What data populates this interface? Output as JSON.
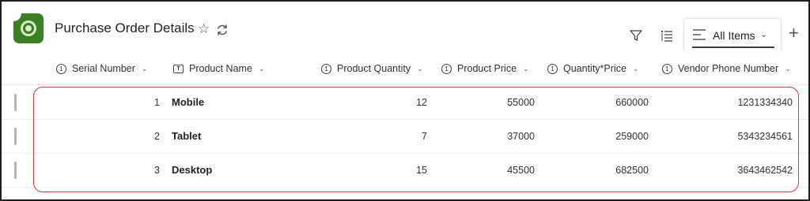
{
  "header": {
    "title": "Purchase Order Details",
    "favorite_icon": "star-icon",
    "sync_icon": "sync-icon",
    "filter_icon": "filter-icon",
    "edit_columns_icon": "list-icon",
    "view_tab_label": "All Items",
    "view_tab_icon": "lines-icon",
    "add_view_label": "+",
    "colors": {
      "logo": "#3a7f22",
      "highlight": "#d63c3c"
    }
  },
  "columns": [
    {
      "label": "Serial Number",
      "type": "number"
    },
    {
      "label": "Product Name",
      "type": "text"
    },
    {
      "label": "Product Quantity",
      "type": "number"
    },
    {
      "label": "Product Price",
      "type": "number"
    },
    {
      "label": "Quantity*Price",
      "type": "number"
    },
    {
      "label": "Vendor Phone Number",
      "type": "number"
    }
  ],
  "column_type_symbols": {
    "number": "1",
    "text": "T"
  },
  "rows": [
    {
      "serial": "1",
      "name": "Mobile",
      "quantity": "12",
      "price": "55000",
      "total": "660000",
      "phone": "1231334340"
    },
    {
      "serial": "2",
      "name": "Tablet",
      "quantity": "7",
      "price": "37000",
      "total": "259000",
      "phone": "5343234561"
    },
    {
      "serial": "3",
      "name": "Desktop",
      "quantity": "15",
      "price": "45500",
      "total": "682500",
      "phone": "3643462542"
    }
  ]
}
